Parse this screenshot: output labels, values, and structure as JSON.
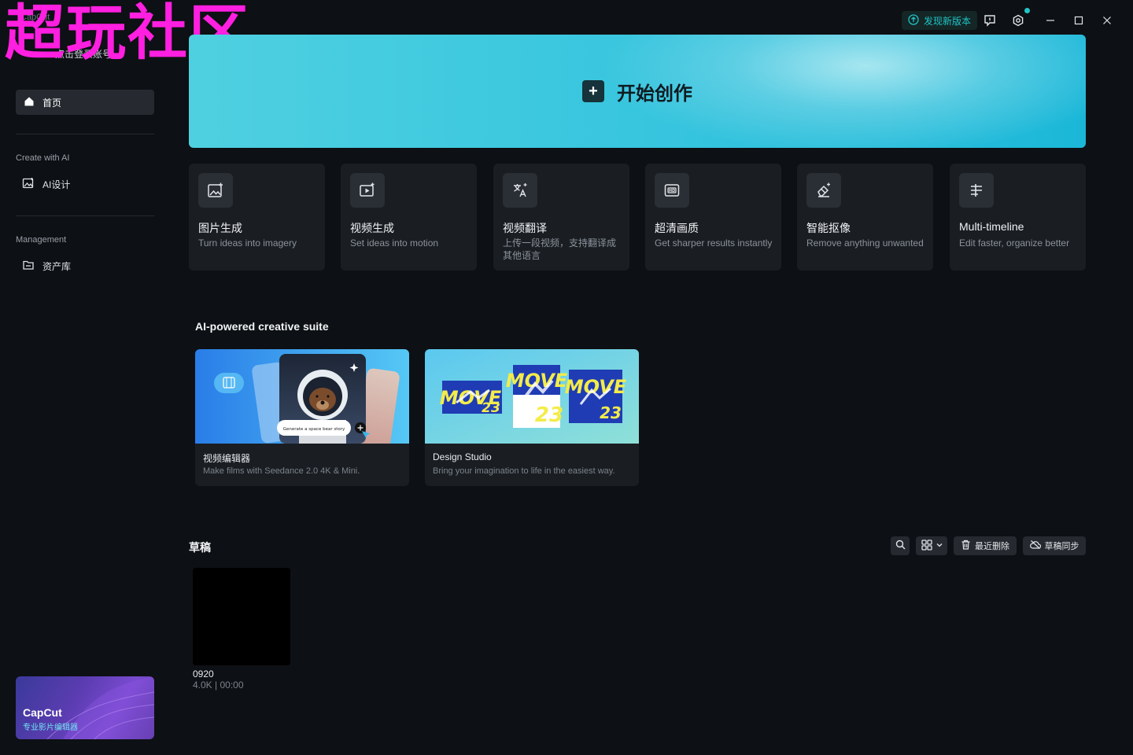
{
  "titlebar": {
    "app_brand": "CapCut",
    "login_text": "点击登录账号",
    "update_label": "发现新版本",
    "watermark": "超玩社区"
  },
  "sidebar": {
    "home_label": "首页",
    "section_ai": "Create with AI",
    "ai_design_label": "AI设计",
    "section_management": "Management",
    "assets_label": "资产库",
    "promo_title": "CapCut",
    "promo_sub": "专业影片编辑器"
  },
  "hero": {
    "title": "开始创作"
  },
  "features": [
    {
      "title": "图片生成",
      "sub": "Turn ideas into imagery",
      "icon": "image-ai-icon"
    },
    {
      "title": "视频生成",
      "sub": "Set ideas into motion",
      "icon": "video-ai-icon"
    },
    {
      "title": "视频翻译",
      "sub": "上传一段视频，支持翻译成其他语言",
      "icon": "translate-icon"
    },
    {
      "title": "超清画质",
      "sub": "Get sharper results instantly",
      "icon": "hd-icon"
    },
    {
      "title": "智能抠像",
      "sub": "Remove anything unwanted",
      "icon": "eraser-icon"
    },
    {
      "title": "Multi-timeline",
      "sub": "Edit faster, organize better",
      "icon": "timeline-icon"
    }
  ],
  "suite": {
    "title": "AI-powered creative suite",
    "cards": [
      {
        "title": "视频编辑器",
        "sub": "Make films with Seedance 2.0 4K & Mini.",
        "prompt": "Generate a space bear story"
      },
      {
        "title": "Design Studio",
        "sub": "Bring your imagination to life in the easiest way.",
        "poster_text": "MOVE",
        "poster_num": "23"
      }
    ]
  },
  "drafts": {
    "title": "草稿",
    "recent_delete": "最近删除",
    "sync": "草稿同步",
    "items": [
      {
        "name": "0920",
        "meta": "4.0K | 00:00"
      }
    ]
  },
  "colors": {
    "accent": "#21c3c6",
    "background": "#0d1014",
    "card": "#1a1e23"
  }
}
